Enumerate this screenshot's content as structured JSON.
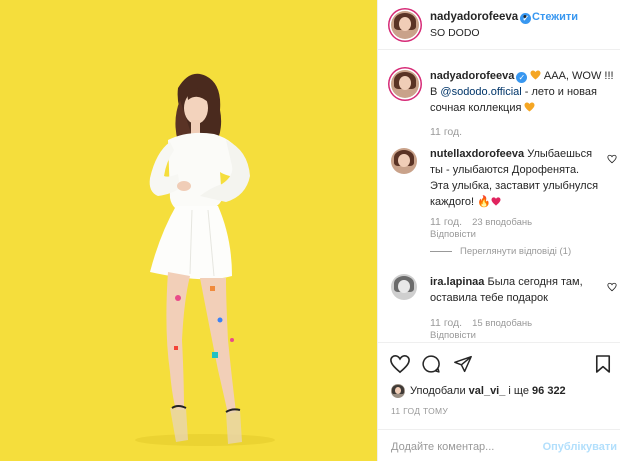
{
  "header": {
    "username": "nadyadorofeeva",
    "separator": "•",
    "follow_label": "Стежити",
    "location": "SO DODO"
  },
  "caption": {
    "username": "nadyadorofeeva",
    "text_start": "AAA, WOW !!!",
    "text_in": "В ",
    "mention": "@sododo.official",
    "text_rest": " - лето и новая сочная коллекция",
    "time": "11 год."
  },
  "comments": [
    {
      "username": "nutellaxdorofeeva",
      "text": "Улыбаешься ты - улыбаются Дорофенята. Эта улыбка, заставит улыбнулся каждого!",
      "time": "11 год.",
      "likes": "23 вподобань",
      "reply_label": "Відповісти",
      "view_replies": "Переглянути відповіді (1)"
    },
    {
      "username": "ira.lapinaa",
      "text": "Была сегодня там, оставила тебе подарок",
      "time": "11 год.",
      "likes": "15 вподобань",
      "reply_label": "Відповісти"
    }
  ],
  "footer": {
    "liked_by_prefix": "Уподобали ",
    "liked_by_user": "val_vi_",
    "liked_by_suffix": " і ще ",
    "likes_count": "96 322",
    "timeago": "11 ГОД ТОМУ",
    "comment_placeholder": "Додайте коментар...",
    "publish_label": "Опублікувати"
  },
  "colors": {
    "photo_background": "#f5de3c",
    "link_blue": "#3897f0",
    "heart_orange": "#f5a623",
    "heart_red": "#e0245e"
  },
  "icons": [
    "heart-icon",
    "comment-icon",
    "share-icon",
    "bookmark-icon",
    "verified-icon",
    "fire-icon"
  ]
}
